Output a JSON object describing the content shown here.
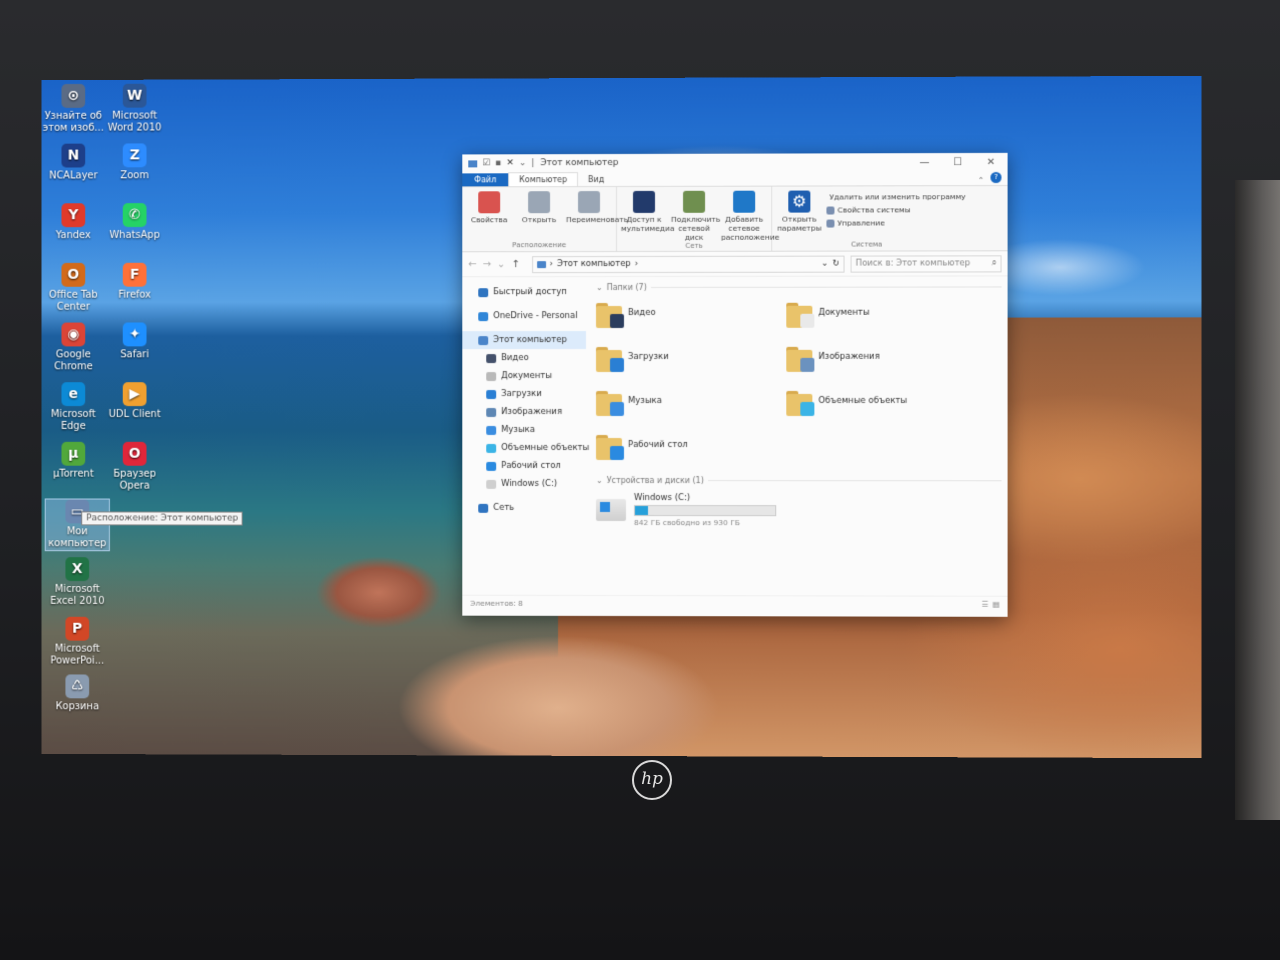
{
  "desktop": {
    "icons": [
      {
        "name": "about-image-icon",
        "label": "Узнайте об этом изоб...",
        "glyph": "⊙",
        "color": "#5a6b85"
      },
      {
        "name": "word-icon",
        "label": "Microsoft Word 2010",
        "glyph": "W",
        "color": "#2b5797"
      },
      {
        "name": "ncalayer-icon",
        "label": "NCALayer",
        "glyph": "N",
        "color": "#1d3f8a"
      },
      {
        "name": "zoom-icon",
        "label": "Zoom",
        "glyph": "Z",
        "color": "#2d8cff"
      },
      {
        "name": "yandex-icon",
        "label": "Yandex",
        "glyph": "Y",
        "color": "#e03a2b"
      },
      {
        "name": "whatsapp-icon",
        "label": "WhatsApp",
        "glyph": "✆",
        "color": "#25d366"
      },
      {
        "name": "office-tab-icon",
        "label": "Office Tab Center",
        "glyph": "O",
        "color": "#d26a1b"
      },
      {
        "name": "firefox-icon",
        "label": "Firefox",
        "glyph": "F",
        "color": "#ff7139"
      },
      {
        "name": "chrome-icon",
        "label": "Google Chrome",
        "glyph": "◉",
        "color": "#db4437"
      },
      {
        "name": "safari-icon",
        "label": "Safari",
        "glyph": "✦",
        "color": "#1e90ff"
      },
      {
        "name": "edge-icon",
        "label": "Microsoft Edge",
        "glyph": "e",
        "color": "#0c8ad6"
      },
      {
        "name": "udl-client-icon",
        "label": "UDL Client",
        "glyph": "▶",
        "color": "#f0a030"
      },
      {
        "name": "utorrent-icon",
        "label": "µTorrent",
        "glyph": "µ",
        "color": "#51a83b"
      },
      {
        "name": "opera-icon",
        "label": "Браузер Opera",
        "glyph": "O",
        "color": "#e0263a"
      },
      {
        "name": "my-computer-icon",
        "label": "Мои компьютер",
        "glyph": "▭",
        "color": "#6a87b0"
      },
      {
        "name": "excel-icon",
        "label": "Microsoft Excel 2010",
        "glyph": "X",
        "color": "#217346"
      },
      {
        "name": "powerpoint-icon",
        "label": "Microsoft PowerPoi...",
        "glyph": "P",
        "color": "#d24726"
      },
      {
        "name": "recycle-bin-icon",
        "label": "Корзина",
        "glyph": "♺",
        "color": "#8a9bb0"
      }
    ],
    "tooltip": "Расположение: Этот компьютер"
  },
  "explorer": {
    "title": "Этот компьютер",
    "window_buttons": [
      "—",
      "☐",
      "✕"
    ],
    "tabs": {
      "file": "Файл",
      "computer": "Компьютер",
      "view": "Вид"
    },
    "ribbon": {
      "location": {
        "caption": "Расположение",
        "buttons": [
          {
            "label": "Свойства",
            "color": "#d9534f"
          },
          {
            "label": "Открыть",
            "color": "#9aa6b5"
          },
          {
            "label": "Переименовать",
            "color": "#9aa6b5"
          }
        ]
      },
      "network": {
        "caption": "Сеть",
        "buttons": [
          {
            "label": "Доступ к мультимедиа",
            "color": "#223a6b"
          },
          {
            "label": "Подключить сетевой диск",
            "color": "#6f8f4f"
          },
          {
            "label": "Добавить сетевое расположение",
            "color": "#1f78c8"
          }
        ]
      },
      "system": {
        "caption": "Система",
        "open_params": "Открыть параметры",
        "items": [
          "Удалить или изменить программу",
          "Свойства системы",
          "Управление"
        ]
      }
    },
    "address": {
      "path": "Этот компьютер",
      "search_placeholder": "Поиск в: Этот компьютер"
    },
    "nav": [
      {
        "name": "nav-quick-access",
        "label": "Быстрый доступ",
        "color": "#2f74c0",
        "sub": false,
        "active": false
      },
      {
        "name": "nav-onedrive",
        "label": "OneDrive - Personal",
        "color": "#2f86d8",
        "sub": false,
        "active": false
      },
      {
        "name": "nav-this-pc",
        "label": "Этот компьютер",
        "color": "#4a84c9",
        "sub": false,
        "active": true
      },
      {
        "name": "nav-videos",
        "label": "Видео",
        "color": "#44516b",
        "sub": true,
        "active": false
      },
      {
        "name": "nav-documents",
        "label": "Документы",
        "color": "#b9b9b9",
        "sub": true,
        "active": false
      },
      {
        "name": "nav-downloads",
        "label": "Загрузки",
        "color": "#2a7fd4",
        "sub": true,
        "active": false
      },
      {
        "name": "nav-pictures",
        "label": "Изображения",
        "color": "#5e87b4",
        "sub": true,
        "active": false
      },
      {
        "name": "nav-music",
        "label": "Музыка",
        "color": "#3a8de0",
        "sub": true,
        "active": false
      },
      {
        "name": "nav-3d-objects",
        "label": "Объемные объекты",
        "color": "#3bb4e6",
        "sub": true,
        "active": false
      },
      {
        "name": "nav-desktop",
        "label": "Рабочий стол",
        "color": "#2a8ae0",
        "sub": true,
        "active": false
      },
      {
        "name": "nav-windows-c",
        "label": "Windows (C:)",
        "color": "#cfcfcf",
        "sub": true,
        "active": false
      },
      {
        "name": "nav-network",
        "label": "Сеть",
        "color": "#2f74c0",
        "sub": false,
        "active": false
      }
    ],
    "folders_header": "Папки (7)",
    "folders": [
      {
        "name": "folder-videos",
        "label": "Видео",
        "badge": "#2b3d5e"
      },
      {
        "name": "folder-documents",
        "label": "Документы",
        "badge": "#e9e9e9"
      },
      {
        "name": "folder-downloads",
        "label": "Загрузки",
        "badge": "#2a7fd4"
      },
      {
        "name": "folder-pictures",
        "label": "Изображения",
        "badge": "#6b92bf"
      },
      {
        "name": "folder-music",
        "label": "Музыка",
        "badge": "#3a8de0"
      },
      {
        "name": "folder-3d-objects",
        "label": "Объемные объекты",
        "badge": "#3bb4e6"
      },
      {
        "name": "folder-desktop",
        "label": "Рабочий стол",
        "badge": "#2a8ae0"
      }
    ],
    "devices_header": "Устройства и диски (1)",
    "drive": {
      "label": "Windows (C:)",
      "free": "842 ГБ свободно из 930 ГБ",
      "used_fraction": 0.095
    },
    "status": "Элементов: 8"
  },
  "laptop": {
    "brand": "hp"
  }
}
